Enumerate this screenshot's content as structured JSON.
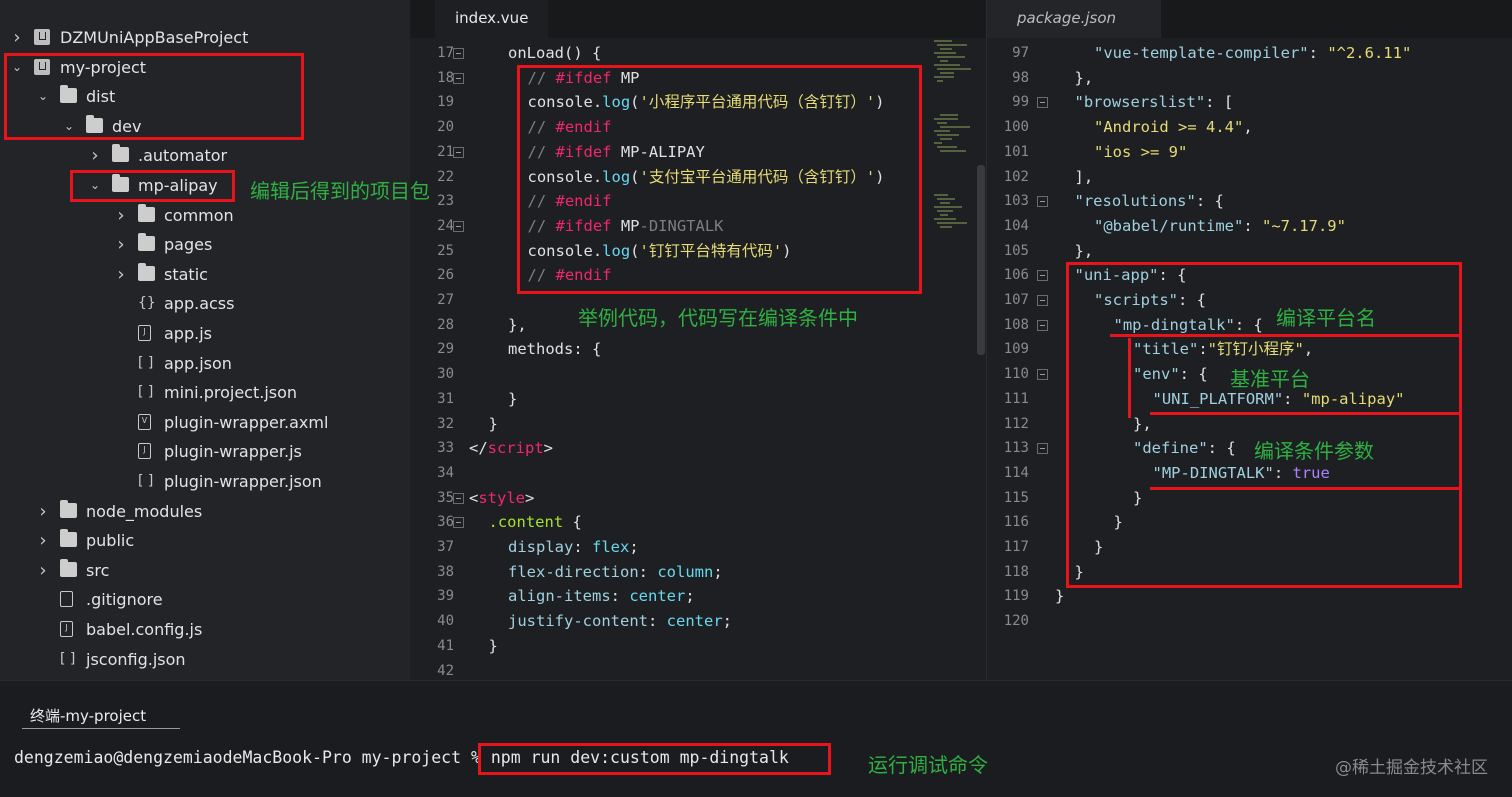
{
  "sidebar": {
    "items": [
      {
        "label": "DZMUniAppBaseProject",
        "depth": 0,
        "icon": "project-icon",
        "chevron": "right"
      },
      {
        "label": "my-project",
        "depth": 0,
        "icon": "project-icon",
        "chevron": "down"
      },
      {
        "label": "dist",
        "depth": 1,
        "icon": "folder-icon",
        "chevron": "down"
      },
      {
        "label": "dev",
        "depth": 2,
        "icon": "folder-icon",
        "chevron": "down"
      },
      {
        "label": ".automator",
        "depth": 3,
        "icon": "folder-icon",
        "chevron": "right"
      },
      {
        "label": "mp-alipay",
        "depth": 3,
        "icon": "folder-icon",
        "chevron": "down"
      },
      {
        "label": "common",
        "depth": 4,
        "icon": "folder-icon",
        "chevron": "right"
      },
      {
        "label": "pages",
        "depth": 4,
        "icon": "folder-icon",
        "chevron": "right"
      },
      {
        "label": "static",
        "depth": 4,
        "icon": "folder-icon",
        "chevron": "right"
      },
      {
        "label": "app.acss",
        "depth": 4,
        "icon": "braces-icon",
        "glyph": "{}"
      },
      {
        "label": "app.js",
        "depth": 4,
        "icon": "file-js-icon",
        "glyph": "J"
      },
      {
        "label": "app.json",
        "depth": 4,
        "icon": "brackets-icon",
        "glyph": "[ ]"
      },
      {
        "label": "mini.project.json",
        "depth": 4,
        "icon": "brackets-icon",
        "glyph": "[ ]"
      },
      {
        "label": "plugin-wrapper.axml",
        "depth": 4,
        "icon": "file-v-icon",
        "glyph": "V"
      },
      {
        "label": "plugin-wrapper.js",
        "depth": 4,
        "icon": "file-js-icon",
        "glyph": "J"
      },
      {
        "label": "plugin-wrapper.json",
        "depth": 4,
        "icon": "brackets-icon",
        "glyph": "[ ]"
      },
      {
        "label": "node_modules",
        "depth": 1,
        "icon": "folder-icon",
        "chevron": "right"
      },
      {
        "label": "public",
        "depth": 1,
        "icon": "folder-icon",
        "chevron": "right"
      },
      {
        "label": "src",
        "depth": 1,
        "icon": "folder-icon",
        "chevron": "right"
      },
      {
        "label": ".gitignore",
        "depth": 1,
        "icon": "file-icon",
        "glyph": ""
      },
      {
        "label": "babel.config.js",
        "depth": 1,
        "icon": "file-js-icon",
        "glyph": "J"
      },
      {
        "label": "jsconfig.json",
        "depth": 1,
        "icon": "brackets-icon",
        "glyph": "[ ]"
      }
    ]
  },
  "editor_left": {
    "tab": "index.vue",
    "lines": [
      {
        "n": "17",
        "fold": true,
        "indent": 2,
        "tokens": [
          [
            "fn-plain",
            "onLoad"
          ],
          [
            "pun",
            "() {"
          ]
        ]
      },
      {
        "n": "18",
        "fold": true,
        "indent": 3,
        "tokens": [
          [
            "cm",
            "// "
          ],
          [
            "kw",
            "#ifdef"
          ],
          [
            "pun",
            " MP"
          ]
        ]
      },
      {
        "n": "19",
        "fold": false,
        "indent": 3,
        "tokens": [
          [
            "pun",
            "console."
          ],
          [
            "fn",
            "log"
          ],
          [
            "pun",
            "("
          ],
          [
            "str",
            "'小程序平台通用代码（含钉钉）'"
          ],
          [
            "pun",
            ")"
          ]
        ]
      },
      {
        "n": "20",
        "fold": false,
        "indent": 3,
        "tokens": [
          [
            "cm",
            "// "
          ],
          [
            "kw",
            "#endif"
          ]
        ]
      },
      {
        "n": "21",
        "fold": true,
        "indent": 3,
        "tokens": [
          [
            "cm",
            "// "
          ],
          [
            "kw",
            "#ifdef"
          ],
          [
            "pun",
            " MP-ALIPAY"
          ]
        ]
      },
      {
        "n": "22",
        "fold": false,
        "indent": 3,
        "tokens": [
          [
            "pun",
            "console."
          ],
          [
            "fn",
            "log"
          ],
          [
            "pun",
            "("
          ],
          [
            "str",
            "'支付宝平台通用代码（含钉钉）'"
          ],
          [
            "pun",
            ")"
          ]
        ]
      },
      {
        "n": "23",
        "fold": false,
        "indent": 3,
        "tokens": [
          [
            "cm",
            "// "
          ],
          [
            "kw",
            "#endif"
          ]
        ]
      },
      {
        "n": "24",
        "fold": true,
        "indent": 3,
        "tokens": [
          [
            "cm",
            "// "
          ],
          [
            "kw",
            "#ifdef"
          ],
          [
            "pun",
            " MP"
          ],
          [
            "cm",
            "-DINGTALK"
          ]
        ]
      },
      {
        "n": "25",
        "fold": false,
        "indent": 3,
        "tokens": [
          [
            "pun",
            "console."
          ],
          [
            "fn",
            "log"
          ],
          [
            "pun",
            "("
          ],
          [
            "str",
            "'钉钉平台特有代码'"
          ],
          [
            "pun",
            ")"
          ]
        ]
      },
      {
        "n": "26",
        "fold": false,
        "indent": 3,
        "tokens": [
          [
            "cm",
            "// "
          ],
          [
            "kw",
            "#endif"
          ]
        ]
      },
      {
        "n": "27",
        "fold": false,
        "indent": 0,
        "tokens": []
      },
      {
        "n": "28",
        "fold": false,
        "indent": 2,
        "tokens": [
          [
            "pun",
            "},"
          ]
        ]
      },
      {
        "n": "29",
        "fold": false,
        "indent": 2,
        "tokens": [
          [
            "pun",
            "methods: {"
          ]
        ]
      },
      {
        "n": "30",
        "fold": false,
        "indent": 0,
        "tokens": []
      },
      {
        "n": "31",
        "fold": false,
        "indent": 2,
        "tokens": [
          [
            "pun",
            "}"
          ]
        ]
      },
      {
        "n": "32",
        "fold": false,
        "indent": 1,
        "tokens": [
          [
            "pun",
            "}"
          ]
        ]
      },
      {
        "n": "33",
        "fold": false,
        "indent": 0,
        "tokens": [
          [
            "pun",
            "</"
          ],
          [
            "kw",
            "script"
          ],
          [
            "pun",
            ">"
          ]
        ]
      },
      {
        "n": "34",
        "fold": false,
        "indent": 0,
        "tokens": []
      },
      {
        "n": "35",
        "fold": true,
        "indent": 0,
        "tokens": [
          [
            "pun",
            "<"
          ],
          [
            "kw",
            "style"
          ],
          [
            "pun",
            ">"
          ]
        ]
      },
      {
        "n": "36",
        "fold": true,
        "indent": 1,
        "tokens": [
          [
            "sel",
            ".content"
          ],
          [
            "pun",
            " {"
          ]
        ]
      },
      {
        "n": "37",
        "fold": false,
        "indent": 2,
        "tokens": [
          [
            "prop",
            "display"
          ],
          [
            "pun",
            ": "
          ],
          [
            "fn",
            "flex"
          ],
          [
            "pun",
            ";"
          ]
        ]
      },
      {
        "n": "38",
        "fold": false,
        "indent": 2,
        "tokens": [
          [
            "prop",
            "flex-direction"
          ],
          [
            "pun",
            ": "
          ],
          [
            "fn",
            "column"
          ],
          [
            "pun",
            ";"
          ]
        ]
      },
      {
        "n": "39",
        "fold": false,
        "indent": 2,
        "tokens": [
          [
            "prop",
            "align-items"
          ],
          [
            "pun",
            ": "
          ],
          [
            "fn",
            "center"
          ],
          [
            "pun",
            ";"
          ]
        ]
      },
      {
        "n": "40",
        "fold": false,
        "indent": 2,
        "tokens": [
          [
            "prop",
            "justify-content"
          ],
          [
            "pun",
            ": "
          ],
          [
            "fn",
            "center"
          ],
          [
            "pun",
            ";"
          ]
        ]
      },
      {
        "n": "41",
        "fold": false,
        "indent": 1,
        "tokens": [
          [
            "pun",
            "}"
          ]
        ]
      },
      {
        "n": "42",
        "fold": false,
        "indent": 0,
        "tokens": []
      }
    ]
  },
  "editor_right": {
    "tab": "package.json",
    "lines": [
      {
        "n": "97",
        "fold": false,
        "indent": 2,
        "tokens": [
          [
            "key",
            "\"vue-template-compiler\""
          ],
          [
            "pun",
            ": "
          ],
          [
            "str",
            "\"^2.6.11\""
          ]
        ]
      },
      {
        "n": "98",
        "fold": false,
        "indent": 1,
        "tokens": [
          [
            "pun",
            "},"
          ]
        ]
      },
      {
        "n": "99",
        "fold": true,
        "indent": 1,
        "tokens": [
          [
            "key",
            "\"browserslist\""
          ],
          [
            "pun",
            ": ["
          ]
        ]
      },
      {
        "n": "100",
        "fold": false,
        "indent": 2,
        "tokens": [
          [
            "str",
            "\"Android >= 4.4\""
          ],
          [
            "pun",
            ","
          ]
        ]
      },
      {
        "n": "101",
        "fold": false,
        "indent": 2,
        "tokens": [
          [
            "str",
            "\"ios >= 9\""
          ]
        ]
      },
      {
        "n": "102",
        "fold": false,
        "indent": 1,
        "tokens": [
          [
            "pun",
            "],"
          ]
        ]
      },
      {
        "n": "103",
        "fold": true,
        "indent": 1,
        "tokens": [
          [
            "key",
            "\"resolutions\""
          ],
          [
            "pun",
            ": {"
          ]
        ]
      },
      {
        "n": "104",
        "fold": false,
        "indent": 2,
        "tokens": [
          [
            "key",
            "\"@babel/runtime\""
          ],
          [
            "pun",
            ": "
          ],
          [
            "str",
            "\"~7.17.9\""
          ]
        ]
      },
      {
        "n": "105",
        "fold": false,
        "indent": 1,
        "tokens": [
          [
            "pun",
            "},"
          ]
        ]
      },
      {
        "n": "106",
        "fold": true,
        "indent": 1,
        "tokens": [
          [
            "key",
            "\"uni-app\""
          ],
          [
            "pun",
            ": {"
          ]
        ]
      },
      {
        "n": "107",
        "fold": true,
        "indent": 2,
        "tokens": [
          [
            "key",
            "\"scripts\""
          ],
          [
            "pun",
            ": {"
          ]
        ]
      },
      {
        "n": "108",
        "fold": true,
        "indent": 3,
        "tokens": [
          [
            "key",
            "\"mp-dingtalk\""
          ],
          [
            "pun",
            ": {"
          ]
        ]
      },
      {
        "n": "109",
        "fold": false,
        "indent": 4,
        "tokens": [
          [
            "key",
            "\"title\""
          ],
          [
            "pun",
            ":"
          ],
          [
            "str",
            "\"钉钉小程序\""
          ],
          [
            "pun",
            ","
          ]
        ]
      },
      {
        "n": "110",
        "fold": true,
        "indent": 4,
        "tokens": [
          [
            "key",
            "\"env\""
          ],
          [
            "pun",
            ": {"
          ]
        ]
      },
      {
        "n": "111",
        "fold": false,
        "indent": 5,
        "tokens": [
          [
            "key",
            "\"UNI_PLATFORM\""
          ],
          [
            "pun",
            ": "
          ],
          [
            "str",
            "\"mp-alipay\""
          ]
        ]
      },
      {
        "n": "112",
        "fold": false,
        "indent": 4,
        "tokens": [
          [
            "pun",
            "},"
          ]
        ]
      },
      {
        "n": "113",
        "fold": true,
        "indent": 4,
        "tokens": [
          [
            "key",
            "\"define\""
          ],
          [
            "pun",
            ": {"
          ]
        ]
      },
      {
        "n": "114",
        "fold": false,
        "indent": 5,
        "tokens": [
          [
            "key",
            "\"MP-DINGTALK\""
          ],
          [
            "pun",
            ": "
          ],
          [
            "num",
            "true"
          ]
        ]
      },
      {
        "n": "115",
        "fold": false,
        "indent": 4,
        "tokens": [
          [
            "pun",
            "}"
          ]
        ]
      },
      {
        "n": "116",
        "fold": false,
        "indent": 3,
        "tokens": [
          [
            "pun",
            "}"
          ]
        ]
      },
      {
        "n": "117",
        "fold": false,
        "indent": 2,
        "tokens": [
          [
            "pun",
            "}"
          ]
        ]
      },
      {
        "n": "118",
        "fold": false,
        "indent": 1,
        "tokens": [
          [
            "pun",
            "}"
          ]
        ]
      },
      {
        "n": "119",
        "fold": false,
        "indent": 0,
        "tokens": [
          [
            "pun",
            "}"
          ]
        ]
      },
      {
        "n": "120",
        "fold": false,
        "indent": 0,
        "tokens": []
      }
    ]
  },
  "terminal": {
    "tab": "终端-my-project",
    "prompt": "dengzemiao@dengzemiaodeMacBook-Pro my-project % ",
    "command": "npm run dev:custom mp-dingtalk"
  },
  "annotations": {
    "project_package": "编辑后得到的项目包",
    "example_code": "举例代码，代码写在编译条件中",
    "platform_name": "编译平台名",
    "base_platform": "基准平台",
    "compile_params": "编译条件参数",
    "run_command": "运行调试命令"
  },
  "watermark": "@稀土掘金技术社区",
  "colors": {
    "highlight": "#e8141b",
    "annotation": "#2fb043",
    "keyword": "#f0286a",
    "string": "#e6db74",
    "function": "#66d9ef"
  }
}
